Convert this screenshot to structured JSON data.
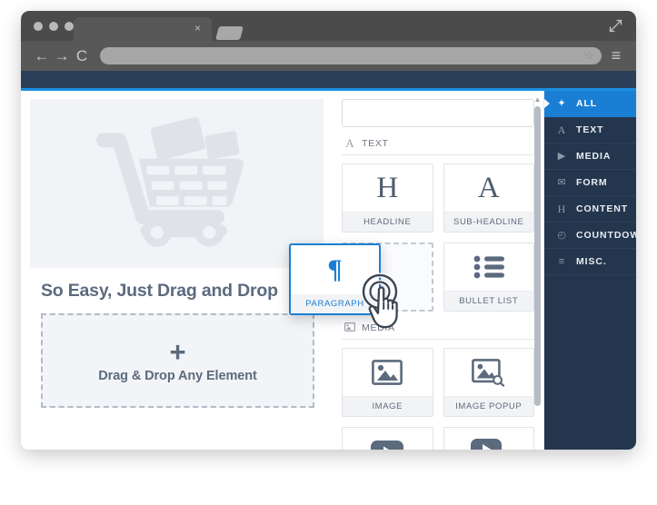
{
  "browser": {
    "tab_close_label": "×",
    "nav": {
      "back_icon": "←",
      "forward_icon": "→",
      "reload_icon": "C",
      "menu_icon": "≡",
      "bookmark_icon": "☆"
    },
    "address_value": "",
    "address_placeholder": ""
  },
  "canvas": {
    "headline": "So Easy, Just Drag and Drop",
    "dropzone": {
      "plus_icon": "+",
      "label": "Drag & Drop Any Element"
    }
  },
  "panel": {
    "search_value": "",
    "search_placeholder": "",
    "sections": [
      {
        "id": "text",
        "icon_glyph": "A",
        "label": "TEXT",
        "cards": [
          {
            "label": "HEADLINE",
            "icon": "headline-icon",
            "glyph": "H"
          },
          {
            "label": "SUB-HEADLINE",
            "icon": "sub-headline-icon",
            "glyph": "A"
          },
          {
            "label": "PARAGRAPH",
            "icon": "paragraph-icon",
            "glyph": "¶",
            "state": "dragging"
          },
          {
            "label": "BULLET LIST",
            "icon": "bullet-list-icon",
            "glyph": ""
          }
        ]
      },
      {
        "id": "media",
        "icon_glyph": "▣",
        "label": "MEDIA",
        "cards": [
          {
            "label": "IMAGE",
            "icon": "image-icon",
            "glyph": ""
          },
          {
            "label": "IMAGE POPUP",
            "icon": "image-popup-icon",
            "glyph": ""
          },
          {
            "label": "",
            "icon": "video-icon",
            "glyph": ""
          },
          {
            "label": "",
            "icon": "video-popup-icon",
            "glyph": ""
          }
        ]
      }
    ],
    "scrollbar": {
      "up_arrow": "▲"
    }
  },
  "sidebar": {
    "items": [
      {
        "label": "ALL",
        "icon": "magic-wand-icon",
        "glyph": "✦",
        "active": true
      },
      {
        "label": "TEXT",
        "icon": "text-a-icon",
        "glyph": "A",
        "active": false
      },
      {
        "label": "MEDIA",
        "icon": "play-icon",
        "glyph": "▶",
        "active": false
      },
      {
        "label": "FORM",
        "icon": "envelope-icon",
        "glyph": "✉",
        "active": false
      },
      {
        "label": "CONTENT",
        "icon": "heading-icon",
        "glyph": "H",
        "active": false
      },
      {
        "label": "COUNTDOWN",
        "icon": "clock-icon",
        "glyph": "◴",
        "active": false
      },
      {
        "label": "MISC.",
        "icon": "list-icon",
        "glyph": "≡",
        "active": false
      }
    ]
  },
  "dragged_card": {
    "label": "PARAGRAPH",
    "glyph": "¶"
  },
  "colors": {
    "accent_blue": "#1a7fd4",
    "sidebar_navy": "#24364d",
    "header_navy": "#2b4058",
    "text_slate": "#5c6a7d",
    "panel_bg": "#ffffff"
  }
}
